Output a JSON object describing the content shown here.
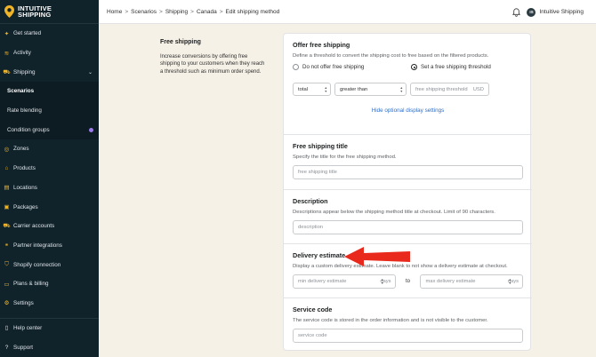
{
  "app": {
    "logo_line1": "INTUITIVE",
    "logo_line2": "SHIPPING"
  },
  "sidebar": {
    "items": [
      {
        "label": "Get started",
        "icon": "sparkle-icon"
      },
      {
        "label": "Activity",
        "icon": "activity-icon"
      },
      {
        "label": "Shipping",
        "icon": "truck-icon"
      },
      {
        "label": "Scenarios",
        "sub": true,
        "active": true
      },
      {
        "label": "Rate blending",
        "sub": true
      },
      {
        "label": "Condition groups",
        "sub": true,
        "badge": true
      },
      {
        "label": "Zones",
        "icon": "globe-icon"
      },
      {
        "label": "Products",
        "icon": "tag-icon"
      },
      {
        "label": "Locations",
        "icon": "building-icon"
      },
      {
        "label": "Packages",
        "icon": "package-icon"
      },
      {
        "label": "Carrier accounts",
        "icon": "truck-icon"
      },
      {
        "label": "Partner integrations",
        "icon": "integrations-icon"
      },
      {
        "label": "Shopify connection",
        "icon": "shopify-icon"
      },
      {
        "label": "Plans & billing",
        "icon": "card-icon"
      },
      {
        "label": "Settings",
        "icon": "gear-icon"
      }
    ],
    "bottom": [
      {
        "label": "Help center",
        "icon": "book-icon"
      },
      {
        "label": "Support",
        "icon": "question-icon"
      }
    ]
  },
  "breadcrumb": [
    "Home",
    "Scenarios",
    "Shipping",
    "Canada",
    "Edit shipping method"
  ],
  "user": {
    "initials": "IS",
    "store": "Intuitive Shipping"
  },
  "left": {
    "title": "Free shipping",
    "text": "Increase conversions by offering free shipping to your customers when they reach a threshold such as minimum order spend."
  },
  "offer": {
    "title": "Offer free shipping",
    "help": "Define a threshold to convert the shipping cost to free based on the filtered products.",
    "option_off": "Do not offer free shipping",
    "option_on": "Set a free shipping threshold",
    "metric": "total",
    "operator": "greater than",
    "threshold_placeholder": "free shipping threshold",
    "threshold_suffix": "USD",
    "toggle_link": "Hide optional display settings"
  },
  "title_section": {
    "title": "Free shipping title",
    "help": "Specify the title for the free shipping method.",
    "placeholder": "free shipping title"
  },
  "description_section": {
    "title": "Description",
    "help": "Descriptions appear below the shipping method title at checkout. Limit of 90 characters.",
    "placeholder": "description"
  },
  "delivery": {
    "title": "Delivery estimate",
    "help": "Display a custom delivery estimate. Leave blank to not show a delivery estimate at checkout.",
    "min_placeholder": "min delivery estimate",
    "max_placeholder": "max delivery estimate",
    "unit": "days",
    "to": "to"
  },
  "service": {
    "title": "Service code",
    "help": "The service code is stored in the order information and is not visible to the customer.",
    "placeholder": "service code"
  },
  "colors": {
    "sidebar_bg": "#10232b",
    "accent_icon": "#f0b429",
    "link": "#2c6ecb",
    "annotation_arrow": "#e8291c",
    "page_bg": "#f6f1e7"
  }
}
